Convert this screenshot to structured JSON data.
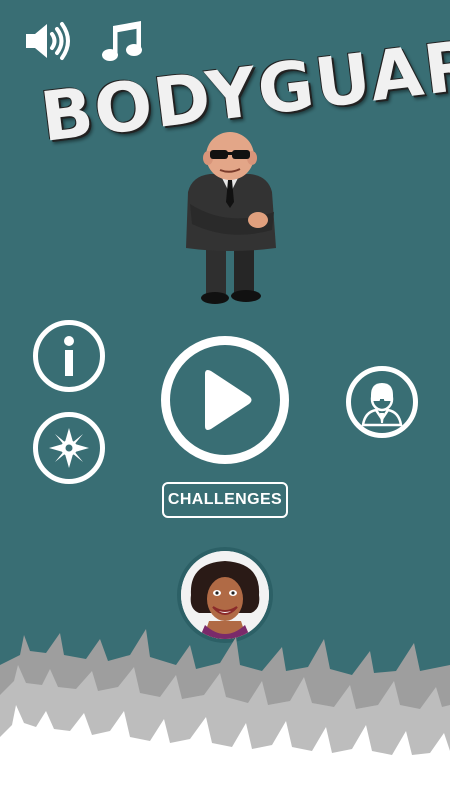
{
  "title": "BODYGUARD",
  "toolbar": {
    "sound_icon": "speaker-icon",
    "music_icon": "music-note-icon"
  },
  "menu": {
    "info_icon": "info-icon",
    "settings_icon": "shuriken-icon",
    "play_icon": "play-icon",
    "character_icon": "agent-avatar-icon",
    "challenges_label": "CHALLENGES",
    "vip_icon": "celebrity-portrait"
  },
  "colors": {
    "background": "#396e74",
    "foreground": "#ffffff",
    "crowd_back": "#9e9e9e",
    "crowd_front": "#ffffff"
  }
}
